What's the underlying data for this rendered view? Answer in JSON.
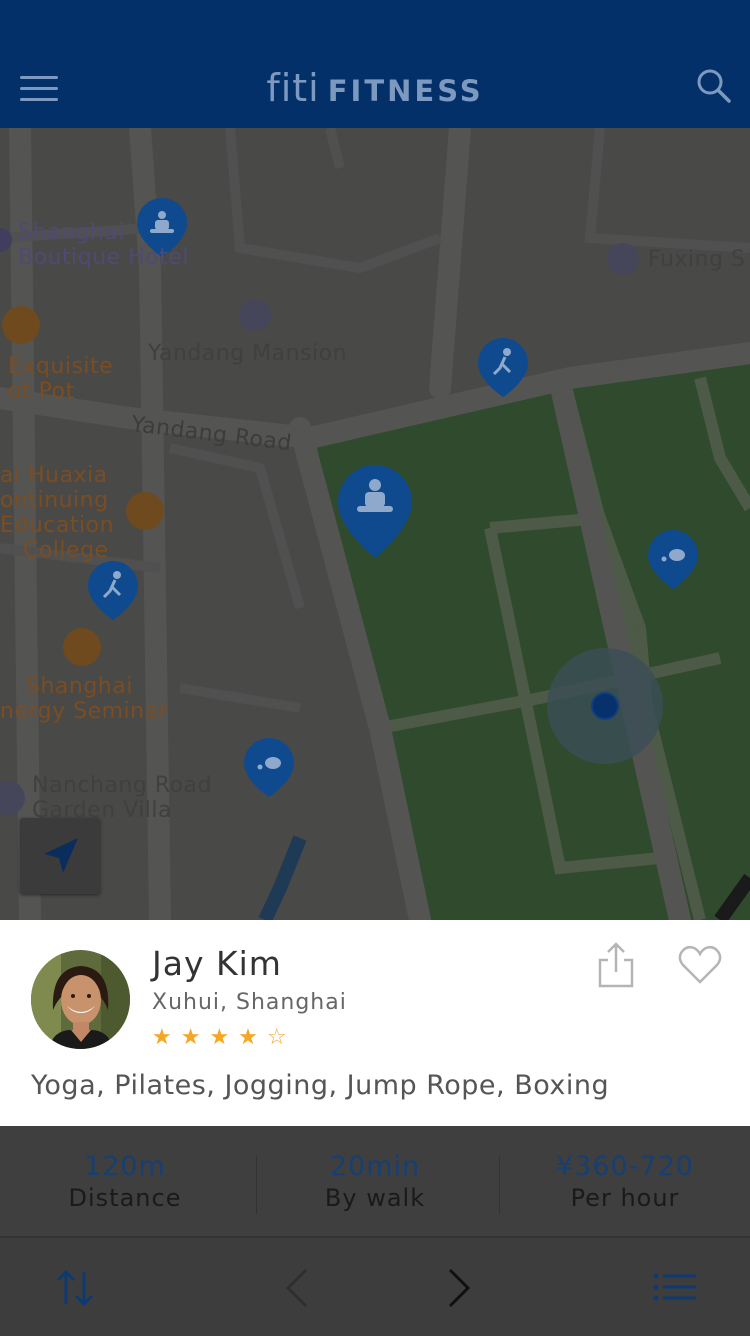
{
  "header": {
    "logo_script": "fiti",
    "logo_word": "FITNESS",
    "menu_icon": "hamburger-menu-icon",
    "search_icon": "search-icon"
  },
  "map": {
    "labels": {
      "boutique_hotel_1": "Shanghai",
      "boutique_hotel_2": "Boutique Hotel",
      "fuxing": "Fuxing S",
      "yandang_mansion": "Yandang Mansion",
      "exquisite_1": "Exquisite",
      "exquisite_2": "ot Pot",
      "yandang_road": "Yandang Road",
      "huaxia_1": "ai Huaxia",
      "huaxia_2": "ontinuing",
      "huaxia_3": "Education",
      "huaxia_4": "College",
      "seminar_1": "Shanghai",
      "seminar_2": "nergy Seminar",
      "nanchang_1": "Nanchang Road",
      "nanchang_2": "Garden Villa"
    },
    "locate_icon": "navigation-arrow-icon"
  },
  "trainer": {
    "name": "Jay Kim",
    "location": "Xuhui, Shanghai",
    "rating": 4,
    "rating_max": 5,
    "stars_display": "★★★★☆",
    "activities": "Yoga, Pilates, Jogging, Jump Rope, Boxing"
  },
  "stats": [
    {
      "value": "120m",
      "label": "Distance"
    },
    {
      "value": "20min",
      "label": "By walk"
    },
    {
      "value": "¥360-720",
      "label": "Per hour"
    }
  ],
  "colors": {
    "primary": "#04306a",
    "star": "#f5a623",
    "pin": "#0f4a8f"
  }
}
